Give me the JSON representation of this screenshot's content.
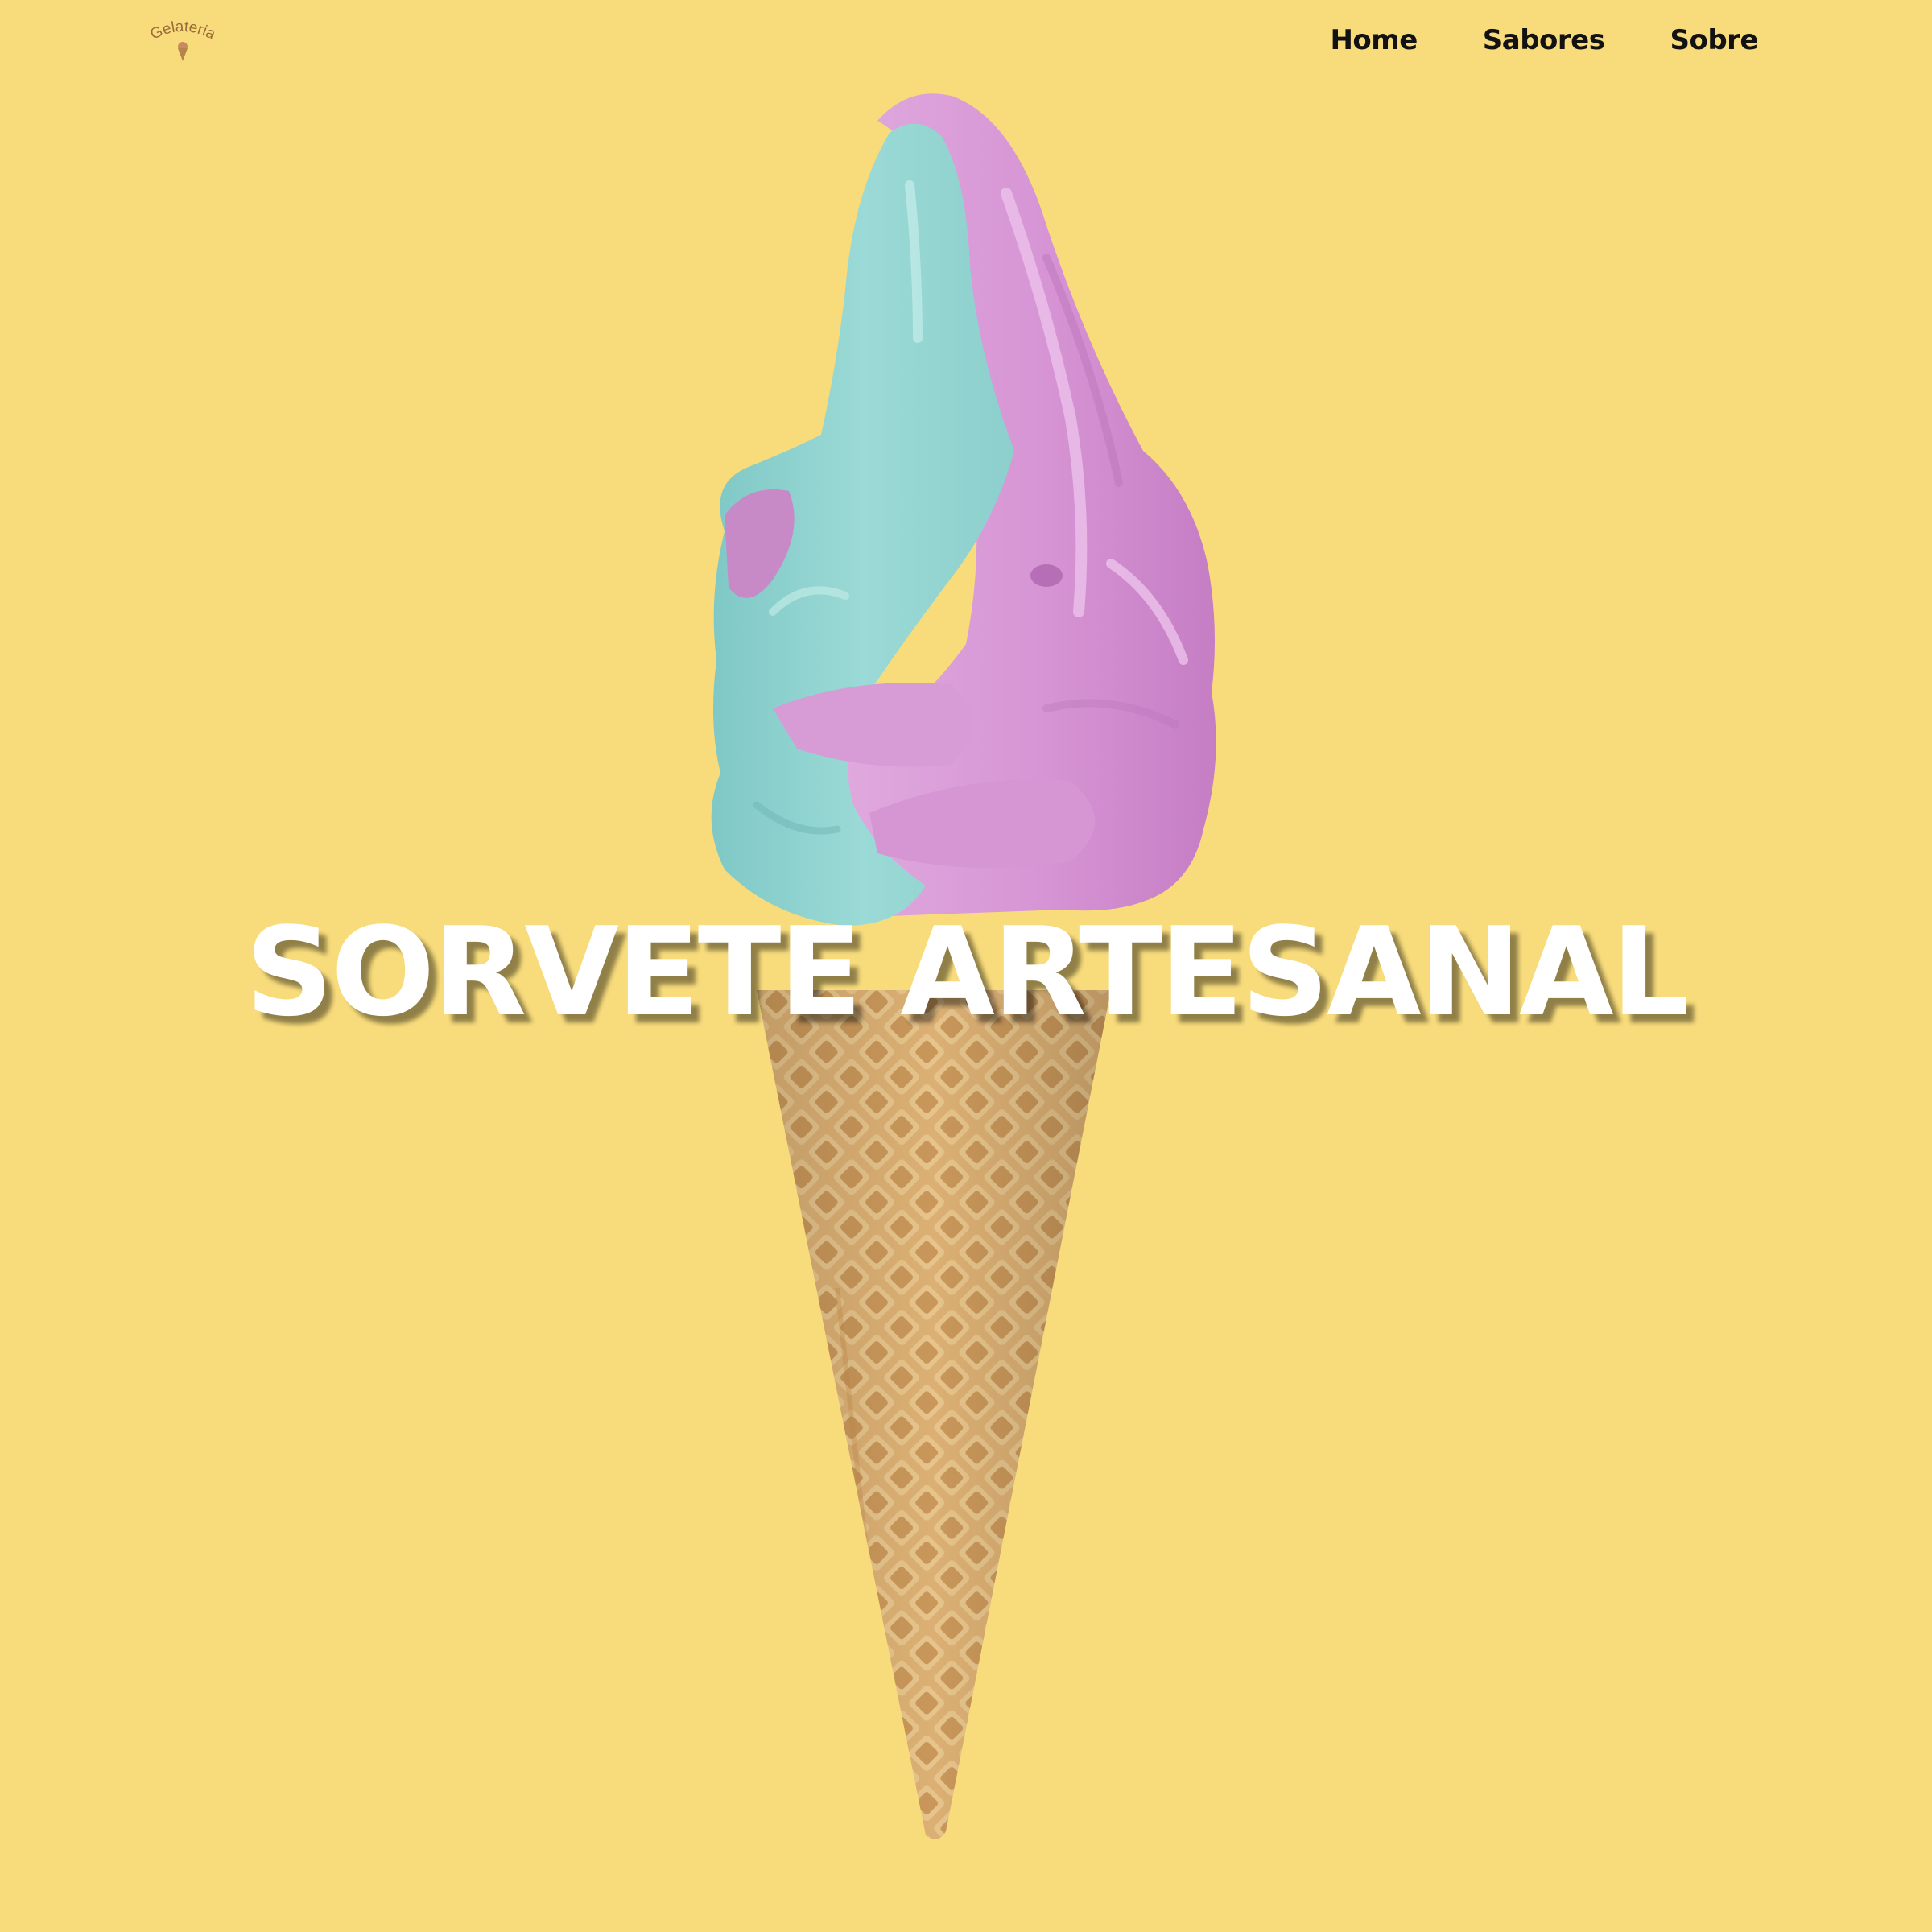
{
  "brand": {
    "logo_text": "Gelateria",
    "logo_color": "#9a6a3a"
  },
  "nav": {
    "items": [
      {
        "label": "Home"
      },
      {
        "label": "Sabores"
      },
      {
        "label": "Sobre"
      }
    ]
  },
  "hero": {
    "title": "SORVETE ARTESANAL",
    "image": "soft-serve-ice-cream-cone",
    "colors": {
      "background": "#f8dc7c",
      "cream_blue": "#8fd3d0",
      "cream_pink": "#d89ad6",
      "cone": "#deb477"
    }
  }
}
